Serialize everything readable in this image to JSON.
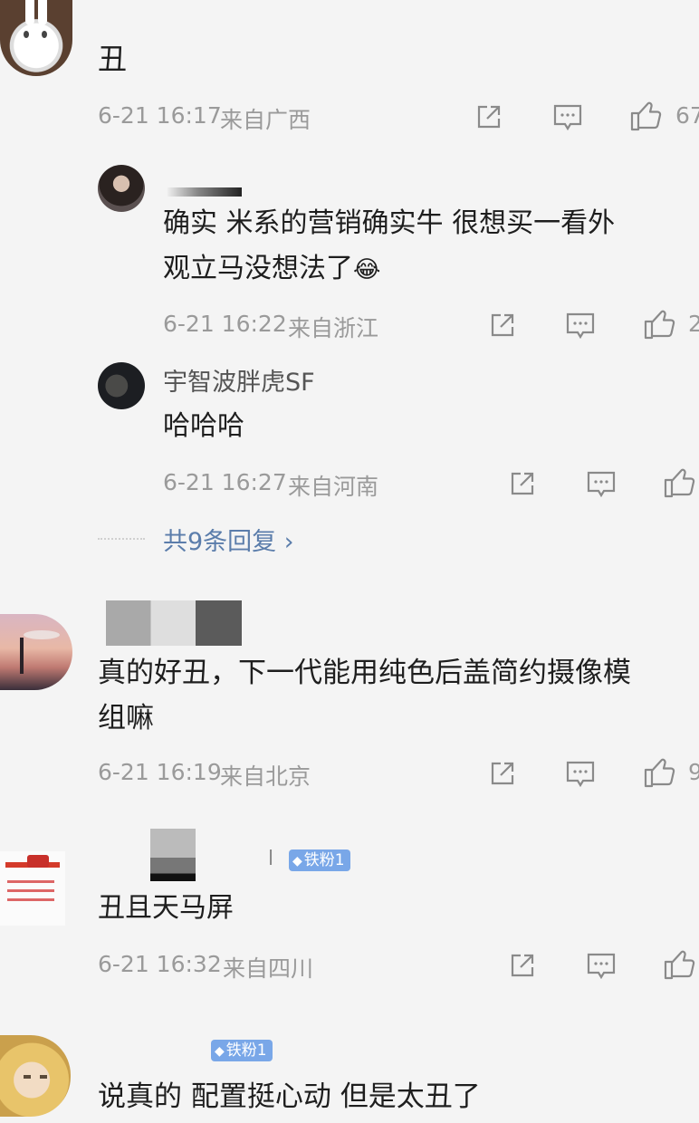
{
  "comments": [
    {
      "text": "丑",
      "time": "6-21 16:17",
      "location": "来自广西",
      "likes": "67"
    },
    {
      "replies": [
        {
          "text_line1": "确实 米系的营销确实牛 很想买一看外",
          "text_line2": "观立马没想法了",
          "emoji": "😂",
          "time": "6-21 16:22",
          "location": "来自浙江",
          "likes": "2"
        },
        {
          "username": "宇智波胖虎SF",
          "text": "哈哈哈",
          "time": "6-21 16:27",
          "location": "来自河南"
        }
      ],
      "more_replies": "共9条回复 ›"
    },
    {
      "text_line1": "真的好丑，下一代能用纯色后盖简约摄像模",
      "text_line2": "组嘛",
      "time": "6-21 16:19",
      "location": "来自北京",
      "likes": "9"
    },
    {
      "username_fragment": "l",
      "badge": "铁粉1",
      "text": "丑且天马屏",
      "time": "6-21 16:32",
      "location": "来自四川"
    },
    {
      "badge": "铁粉1",
      "text": "说真的 配置挺心动 但是太丑了"
    }
  ],
  "icons": {
    "share": "share-icon",
    "comment": "comment-icon",
    "like": "thumbs-up-icon"
  },
  "colors": {
    "background": "#f4f4f4",
    "meta_text": "#9a9a9a",
    "link_blue": "#5b7dab",
    "badge_blue": "#79a7e8"
  }
}
